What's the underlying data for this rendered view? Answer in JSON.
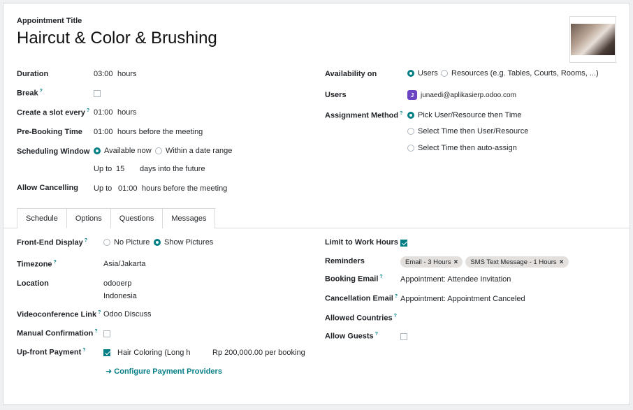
{
  "header": {
    "title_label": "Appointment Title",
    "title": "Haircut & Color & Brushing"
  },
  "left": {
    "duration": {
      "label": "Duration",
      "value": "03:00",
      "unit": "hours"
    },
    "break": {
      "label": "Break",
      "checked": false
    },
    "slot": {
      "label": "Create a slot every",
      "value": "01:00",
      "unit": "hours"
    },
    "prebook": {
      "label": "Pre-Booking Time",
      "value": "01:00",
      "unit": "hours before the meeting"
    },
    "scheduling": {
      "label": "Scheduling Window",
      "opt1": "Available now",
      "opt2": "Within a date range",
      "upto": "Up to",
      "days": "15",
      "days_unit": "days into the future"
    },
    "cancel": {
      "label": "Allow Cancelling",
      "upto": "Up to",
      "value": "01:00",
      "unit": "hours before the meeting"
    }
  },
  "right": {
    "availability": {
      "label": "Availability on",
      "opt1": "Users",
      "opt2": "Resources (e.g. Tables, Courts, Rooms, ...)"
    },
    "users": {
      "label": "Users",
      "badge": "J",
      "email": "junaedi@aplikasierp.odoo.com",
      "badge_color": "#6c45c4"
    },
    "assignment": {
      "label": "Assignment Method",
      "opt1": "Pick User/Resource then Time",
      "opt2": "Select Time then User/Resource",
      "opt3": "Select Time then auto-assign"
    }
  },
  "tabs": [
    "Schedule",
    "Options",
    "Questions",
    "Messages"
  ],
  "options": {
    "frontend": {
      "label": "Front-End Display",
      "opt1": "No Picture",
      "opt2": "Show Pictures"
    },
    "timezone": {
      "label": "Timezone",
      "value": "Asia/Jakarta"
    },
    "location": {
      "label": "Location",
      "line1": "odooerp",
      "line2": "Indonesia"
    },
    "video": {
      "label": "Videoconference Link",
      "value": "Odoo Discuss"
    },
    "manual": {
      "label": "Manual Confirmation"
    },
    "payment": {
      "label": "Up-front Payment",
      "product": "Hair Coloring (Long ha",
      "price": "Rp 200,000.00 per booking",
      "configure": "Configure Payment Providers"
    },
    "limit": {
      "label": "Limit to Work Hours"
    },
    "reminders": {
      "label": "Reminders",
      "tag1": "Email - 3 Hours",
      "tag2": "SMS Text Message - 1 Hours"
    },
    "booking_email": {
      "label": "Booking Email",
      "value": "Appointment: Attendee Invitation"
    },
    "cancel_email": {
      "label": "Cancellation Email",
      "value": "Appointment: Appointment Canceled"
    },
    "countries": {
      "label": "Allowed Countries"
    },
    "guests": {
      "label": "Allow Guests"
    }
  },
  "colors": {
    "accent": "#017e84"
  }
}
